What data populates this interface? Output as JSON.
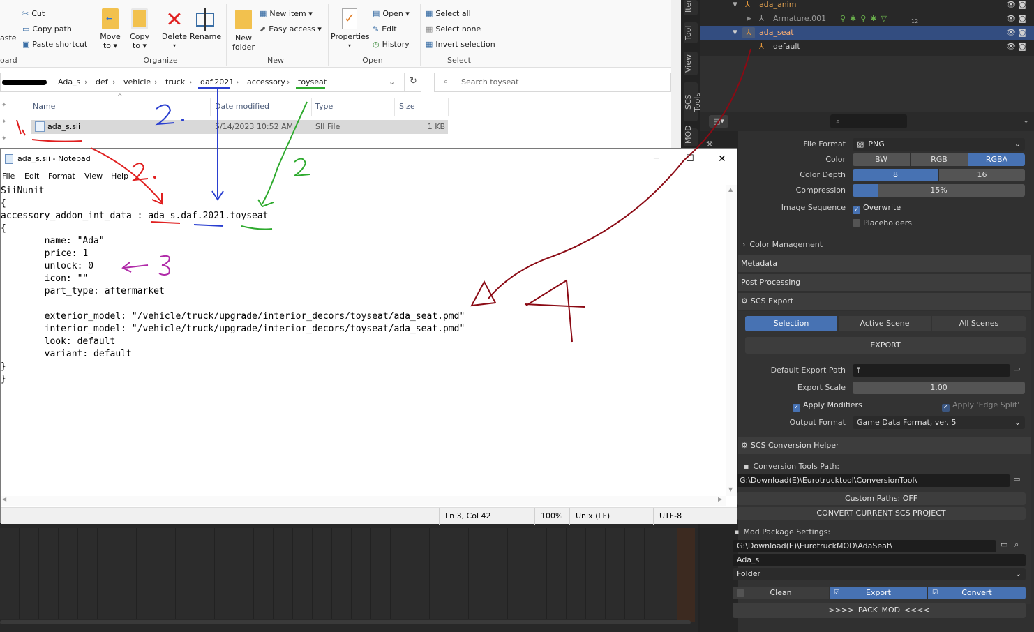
{
  "explorer": {
    "ribbon": {
      "clipboard": {
        "cut": "Cut",
        "copy_path": "Copy path",
        "paste_shortcut": "Paste shortcut",
        "paste_partial": "aste",
        "group_partial": "oard"
      },
      "organize": {
        "move_to_1": "Move",
        "move_to_2": "to ▾",
        "copy_to_1": "Copy",
        "copy_to_2": "to ▾",
        "delete": "Delete",
        "delete_arrow": "▾",
        "rename": "Rename",
        "group": "Organize"
      },
      "new": {
        "new_folder_1": "New",
        "new_folder_2": "folder",
        "new_item": "New item ▾",
        "easy_access": "Easy access ▾",
        "group": "New"
      },
      "open": {
        "properties": "Properties",
        "properties_arrow": "▾",
        "open": "Open ▾",
        "edit": "Edit",
        "history": "History",
        "group": "Open"
      },
      "select": {
        "select_all": "Select all",
        "select_none": "Select none",
        "invert": "Invert selection",
        "group": "Select"
      }
    },
    "breadcrumb": [
      "Ada_s",
      "def",
      "vehicle",
      "truck",
      "daf.2021",
      "accessory",
      "toyseat"
    ],
    "search_placeholder": "Search toyseat",
    "columns": {
      "name": "Name",
      "date": "Date modified",
      "type": "Type",
      "size": "Size"
    },
    "file": {
      "name": "ada_s.sii",
      "date": "5/14/2023 10:52 AM",
      "type": "SII File",
      "size": "1 KB"
    }
  },
  "notepad": {
    "title": "ada_s.sii - Notepad",
    "menu": [
      "File",
      "Edit",
      "Format",
      "View",
      "Help"
    ],
    "lines": [
      "SiiNunit",
      "{",
      "accessory_addon_int_data : ada_s.daf.2021.toyseat",
      "{",
      "        name: \"Ada\"",
      "        price: 1",
      "        unlock: 0",
      "        icon: \"\"",
      "        part_type: aftermarket",
      "",
      "        exterior_model: \"/vehicle/truck/upgrade/interior_decors/toyseat/ada_seat.pmd\"",
      "        interior_model: \"/vehicle/truck/upgrade/interior_decors/toyseat/ada_seat.pmd\"",
      "        look: default",
      "        variant: default",
      "}",
      "}"
    ],
    "status": {
      "position": "Ln 3, Col 42",
      "zoom": "100%",
      "eol": "Unix (LF)",
      "encoding": "UTF-8"
    }
  },
  "annotations": {
    "red_1": "1.",
    "blue_2": "2.",
    "red_2": "2.",
    "green_2": "2.",
    "purple_3": "3",
    "red_4": "4"
  },
  "blender": {
    "tabs": [
      "Item",
      "Tool",
      "View",
      "SCS Tools",
      "MOD"
    ],
    "outliner": [
      {
        "label": "ada_anim"
      },
      {
        "label": "Armature.001",
        "count": "12"
      },
      {
        "label": "ada_seat"
      },
      {
        "label": "default"
      }
    ],
    "output": {
      "file_format_label": "File Format",
      "file_format": "PNG",
      "color_label": "Color",
      "color_options": [
        "BW",
        "RGB",
        "RGBA"
      ],
      "color_selected": "RGBA",
      "depth_label": "Color Depth",
      "depth_options": [
        "8",
        "16"
      ],
      "depth_selected": "8",
      "compression_label": "Compression",
      "compression": "15%",
      "compression_frac": 0.15,
      "image_sequence_label": "Image Sequence",
      "overwrite": "Overwrite",
      "placeholders": "Placeholders",
      "color_management": "Color Management",
      "metadata": "Metadata",
      "post_processing": "Post Processing"
    },
    "scs_export": {
      "title": "SCS Export",
      "scopes": [
        "Selection",
        "Active Scene",
        "All Scenes"
      ],
      "scope_selected": "Selection",
      "export_button": "EXPORT",
      "default_path_label": "Default Export Path",
      "scale_label": "Export Scale",
      "scale": "1.00",
      "apply_modifiers": "Apply Modifiers",
      "apply_edge_split": "Apply 'Edge Split'",
      "output_format_label": "Output Format",
      "output_format": "Game Data Format, ver. 5"
    },
    "conversion": {
      "title": "SCS Conversion Helper",
      "tools_path_label": "Conversion Tools Path:",
      "tools_path": "G:\\Download(E)\\Eurotrucktool\\ConversionTool\\",
      "custom_paths": "Custom Paths: OFF",
      "convert_button": "CONVERT CURRENT SCS PROJECT",
      "mod_package_label": "Mod Package Settings:",
      "mod_path": "G:\\Download(E)\\EurotruckMOD\\AdaSeat\\",
      "mod_name": "Ada_s",
      "mod_type": "Folder",
      "clean": "Clean",
      "export": "Export",
      "convert": "Convert",
      "pack": ">>>>    PACK MOD    <<<<"
    }
  },
  "colors": {
    "blender_bg": "#303030",
    "blender_blue": "#4772b3",
    "annot_red": "#e02020",
    "annot_blue": "#2a3fd0",
    "annot_green": "#2eaa2e",
    "annot_purple": "#b02aa8",
    "annot_dark_red": "#8b0a14"
  }
}
